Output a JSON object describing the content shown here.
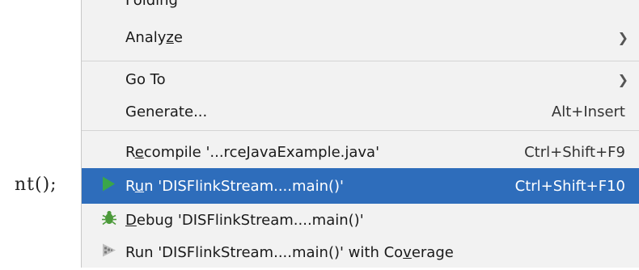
{
  "editor": {
    "code_fragment": "nt();"
  },
  "menu": {
    "partial_item": "Folding",
    "items": [
      {
        "id": "analyze",
        "label_pre": "Analy",
        "label_mnemonic": "z",
        "label_post": "e",
        "shortcut": "",
        "submenu": true
      },
      {
        "id": "goto",
        "label_pre": "Go To",
        "label_mnemonic": "",
        "label_post": "",
        "shortcut": "",
        "submenu": true
      },
      {
        "id": "generate",
        "label_pre": "Generate...",
        "label_mnemonic": "",
        "label_post": "",
        "shortcut": "Alt+Insert",
        "submenu": false
      },
      {
        "id": "recompile",
        "label_pre": "R",
        "label_mnemonic": "e",
        "label_post": "compile '...rceJavaExample.java'",
        "shortcut": "Ctrl+Shift+F9",
        "submenu": false
      },
      {
        "id": "run",
        "label_pre": "R",
        "label_mnemonic": "u",
        "label_post": "n 'DISFlinkStream....main()'",
        "shortcut": "Ctrl+Shift+F10",
        "submenu": false,
        "selected": true
      },
      {
        "id": "debug",
        "label_pre": "",
        "label_mnemonic": "D",
        "label_post": "ebug 'DISFlinkStream....main()'",
        "shortcut": "",
        "submenu": false
      },
      {
        "id": "coverage",
        "label_pre": "Run 'DISFlinkStream....main()' with Co",
        "label_mnemonic": "v",
        "label_post": "erage",
        "shortcut": "",
        "submenu": false
      }
    ],
    "colors": {
      "selection": "#2e6dbb",
      "background": "#f2f2f2",
      "run_icon": "#3aa64a",
      "debug_icon": "#4c9a3a"
    }
  }
}
